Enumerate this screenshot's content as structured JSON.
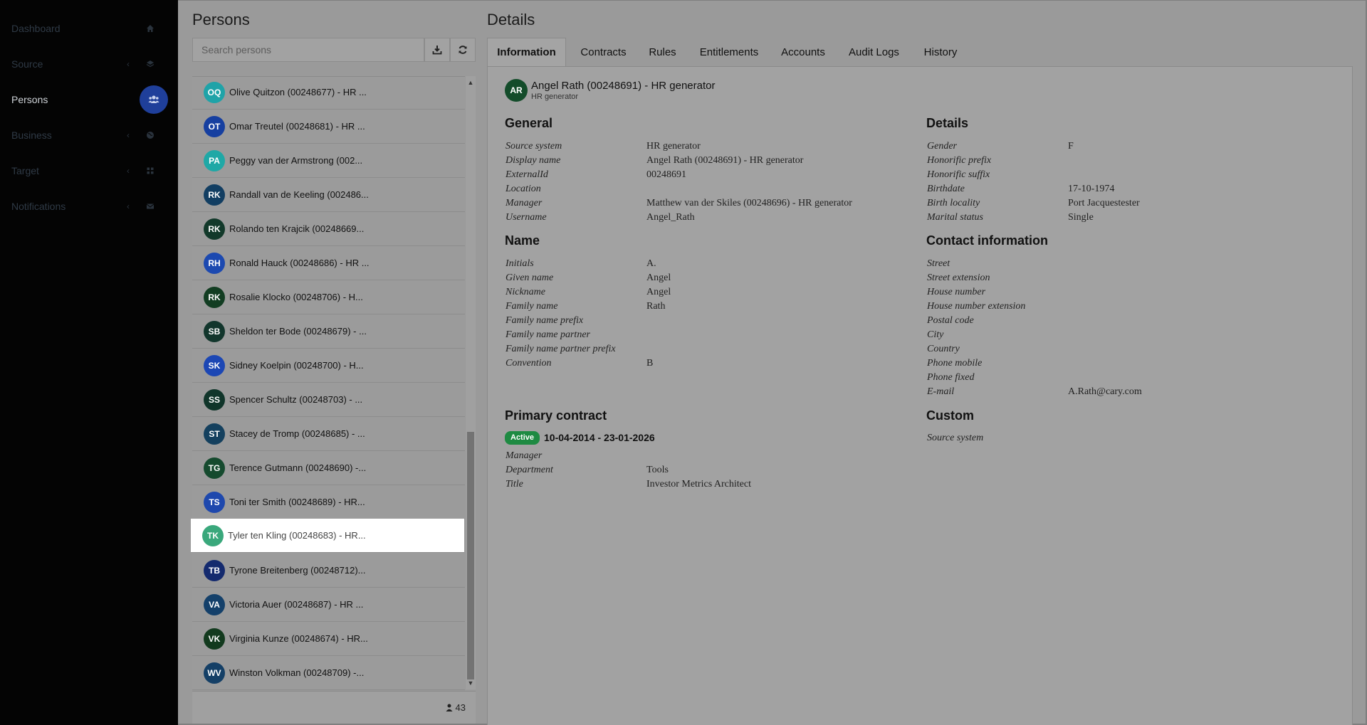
{
  "sidebar": {
    "items": [
      {
        "label": "Dashboard",
        "icon": "home-icon",
        "chevron": false,
        "active": false
      },
      {
        "label": "Source",
        "icon": "layers-icon",
        "chevron": true,
        "active": false
      },
      {
        "label": "Persons",
        "icon": "users-icon",
        "chevron": false,
        "active": true
      },
      {
        "label": "Business",
        "icon": "globe-icon",
        "chevron": true,
        "active": false
      },
      {
        "label": "Target",
        "icon": "grid-icon",
        "chevron": true,
        "active": false
      },
      {
        "label": "Notifications",
        "icon": "envelope-icon",
        "chevron": true,
        "active": false
      }
    ]
  },
  "persons": {
    "title": "Persons",
    "search_placeholder": "Search persons",
    "count": "43",
    "list": [
      {
        "initials": "OQ",
        "name": "Olive Quitzon (00248677) - HR ...",
        "color": "#1fa3a8"
      },
      {
        "initials": "OT",
        "name": "Omar Treutel (00248681) - HR ...",
        "color": "#163fa0"
      },
      {
        "initials": "PA",
        "name": "Peggy van der Armstrong (002...",
        "color": "#1fa8a6"
      },
      {
        "initials": "RK",
        "name": "Randall van de Keeling (002486...",
        "color": "#123e62"
      },
      {
        "initials": "RK",
        "name": "Rolando ten Krajcik (00248669...",
        "color": "#12392a"
      },
      {
        "initials": "RH",
        "name": "Ronald Hauck (00248686) - HR ...",
        "color": "#1c49b0"
      },
      {
        "initials": "RK",
        "name": "Rosalie Klocko (00248706) - H...",
        "color": "#123d22"
      },
      {
        "initials": "SB",
        "name": "Sheldon ter Bode (00248679) - ...",
        "color": "#12362c"
      },
      {
        "initials": "SK",
        "name": "Sidney Koelpin (00248700) - H...",
        "color": "#1c47b4"
      },
      {
        "initials": "SS",
        "name": "Spencer Schultz (00248703) - ...",
        "color": "#10352a"
      },
      {
        "initials": "ST",
        "name": "Stacey de Tromp (00248685) - ...",
        "color": "#14405e"
      },
      {
        "initials": "TG",
        "name": "Terence Gutmann (00248690) -...",
        "color": "#154a2e"
      },
      {
        "initials": "TS",
        "name": "Toni ter Smith (00248689) - HR...",
        "color": "#1e48ad"
      },
      {
        "initials": "TK",
        "name": "Tyler ten Kling (00248683) - HR...",
        "color": "#3aa87c"
      },
      {
        "initials": "TB",
        "name": "Tyrone Breitenberg (00248712)...",
        "color": "#142a6e"
      },
      {
        "initials": "VA",
        "name": "Victoria Auer (00248687) - HR ...",
        "color": "#14406a"
      },
      {
        "initials": "VK",
        "name": "Virginia Kunze (00248674) - HR...",
        "color": "#123a1e"
      },
      {
        "initials": "WV",
        "name": "Winston Volkman (00248709) -...",
        "color": "#143f66"
      }
    ]
  },
  "details": {
    "title": "Details",
    "tabs": [
      "Information",
      "Contracts",
      "Rules",
      "Entitlements",
      "Accounts",
      "Audit Logs",
      "History"
    ],
    "header": {
      "initials": "AR",
      "name": "Angel Rath (00248691) - HR generator",
      "subtitle": "HR generator"
    },
    "general": {
      "title": "General",
      "fields": [
        {
          "label": "Source system",
          "value": "HR generator"
        },
        {
          "label": "Display name",
          "value": "Angel Rath (00248691) - HR generator"
        },
        {
          "label": "ExternalId",
          "value": "00248691"
        },
        {
          "label": "Location",
          "value": ""
        },
        {
          "label": "Manager",
          "value": "Matthew van der Skiles (00248696) - HR generator"
        },
        {
          "label": "Username",
          "value": "Angel_Rath"
        }
      ]
    },
    "name": {
      "title": "Name",
      "fields": [
        {
          "label": "Initials",
          "value": "A."
        },
        {
          "label": "Given name",
          "value": "Angel"
        },
        {
          "label": "Nickname",
          "value": "Angel"
        },
        {
          "label": "Family name",
          "value": "Rath"
        },
        {
          "label": "Family name prefix",
          "value": ""
        },
        {
          "label": "Family name partner",
          "value": ""
        },
        {
          "label": "Family name partner prefix",
          "value": ""
        },
        {
          "label": "Convention",
          "value": "B"
        }
      ]
    },
    "primary_contract": {
      "title": "Primary contract",
      "status": "Active",
      "dates": "10-04-2014 - 23-01-2026",
      "fields": [
        {
          "label": "Manager",
          "value": ""
        },
        {
          "label": "Department",
          "value": "Tools"
        },
        {
          "label": "Title",
          "value": "Investor Metrics Architect"
        }
      ]
    },
    "details_section": {
      "title": "Details",
      "fields": [
        {
          "label": "Gender",
          "value": "F"
        },
        {
          "label": "Honorific prefix",
          "value": ""
        },
        {
          "label": "Honorific suffix",
          "value": ""
        },
        {
          "label": "Birthdate",
          "value": "17-10-1974"
        },
        {
          "label": "Birth locality",
          "value": "Port Jacquestester"
        },
        {
          "label": "Marital status",
          "value": "Single"
        }
      ]
    },
    "contact": {
      "title": "Contact information",
      "fields": [
        {
          "label": "Street",
          "value": ""
        },
        {
          "label": "Street extension",
          "value": ""
        },
        {
          "label": "House number",
          "value": ""
        },
        {
          "label": "House number extension",
          "value": ""
        },
        {
          "label": "Postal code",
          "value": ""
        },
        {
          "label": "City",
          "value": ""
        },
        {
          "label": "Country",
          "value": ""
        },
        {
          "label": "Phone mobile",
          "value": ""
        },
        {
          "label": "Phone fixed",
          "value": ""
        },
        {
          "label": "E-mail",
          "value": "A.Rath@cary.com"
        }
      ]
    },
    "custom": {
      "title": "Custom",
      "fields": [
        {
          "label": "Source system",
          "value": ""
        }
      ]
    }
  }
}
